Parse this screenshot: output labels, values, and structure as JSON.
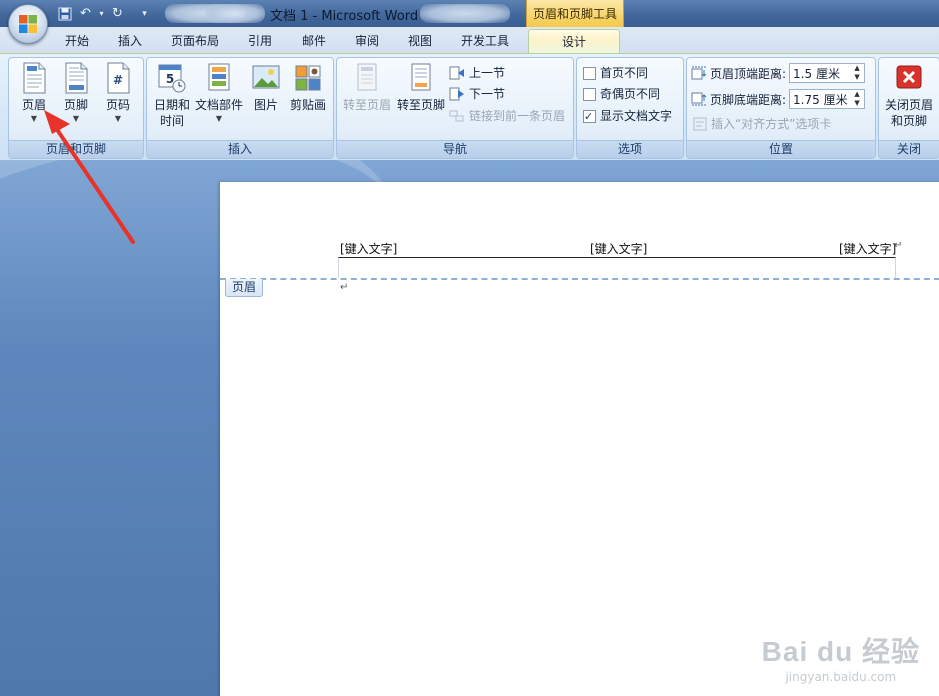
{
  "titlebar": {
    "document_title": "文档 1 - Microsoft Word",
    "context_tool_title": "页眉和页脚工具"
  },
  "tabs": [
    {
      "label": "开始"
    },
    {
      "label": "插入"
    },
    {
      "label": "页面布局"
    },
    {
      "label": "引用"
    },
    {
      "label": "邮件"
    },
    {
      "label": "审阅"
    },
    {
      "label": "视图"
    },
    {
      "label": "开发工具"
    },
    {
      "label": "设计",
      "active": true
    }
  ],
  "ribbon": {
    "header_footer_group": {
      "label": "页眉和页脚",
      "buttons": [
        "页眉",
        "页脚",
        "页码"
      ]
    },
    "insert_group": {
      "label": "插入",
      "date_time_line1": "日期和",
      "date_time_line2": "时间",
      "quick_parts": "文档部件",
      "picture": "图片",
      "clip_art": "剪贴画"
    },
    "navigation_group": {
      "label": "导航",
      "goto_header": "转至页眉",
      "goto_footer": "转至页脚",
      "previous_section": "上一节",
      "next_section": "下一节",
      "link_to_previous": "链接到前一条页眉"
    },
    "options_group": {
      "label": "选项",
      "different_first_page": {
        "label": "首页不同",
        "checked": false
      },
      "different_odd_even": {
        "label": "奇偶页不同",
        "checked": false
      },
      "show_document_text": {
        "label": "显示文档文字",
        "checked": true
      }
    },
    "position_group": {
      "label": "位置",
      "header_from_top_label": "页眉顶端距离:",
      "header_from_top_value": "1.5 厘米",
      "footer_from_bottom_label": "页脚底端距离:",
      "footer_from_bottom_value": "1.75 厘米",
      "insert_alignment_tab": "插入“对齐方式”选项卡"
    },
    "close_group": {
      "label": "关闭",
      "close_line1": "关闭页眉",
      "close_line2": "和页脚"
    }
  },
  "document": {
    "header_placeholders": [
      "[键入文字]",
      "[键入文字]",
      "[键入文字]"
    ],
    "header_tag": "页眉",
    "paragraph_mark": "↵",
    "header_end_mark": "↵"
  },
  "watermark": {
    "brand": "Bai du 经验",
    "url": "jingyan.baidu.com"
  },
  "colors": {
    "active_tab": "#fdf3c9",
    "context_tab": "#f7d56d",
    "annotation_arrow": "#e8332a",
    "close_button_icon": "#d9322c"
  }
}
